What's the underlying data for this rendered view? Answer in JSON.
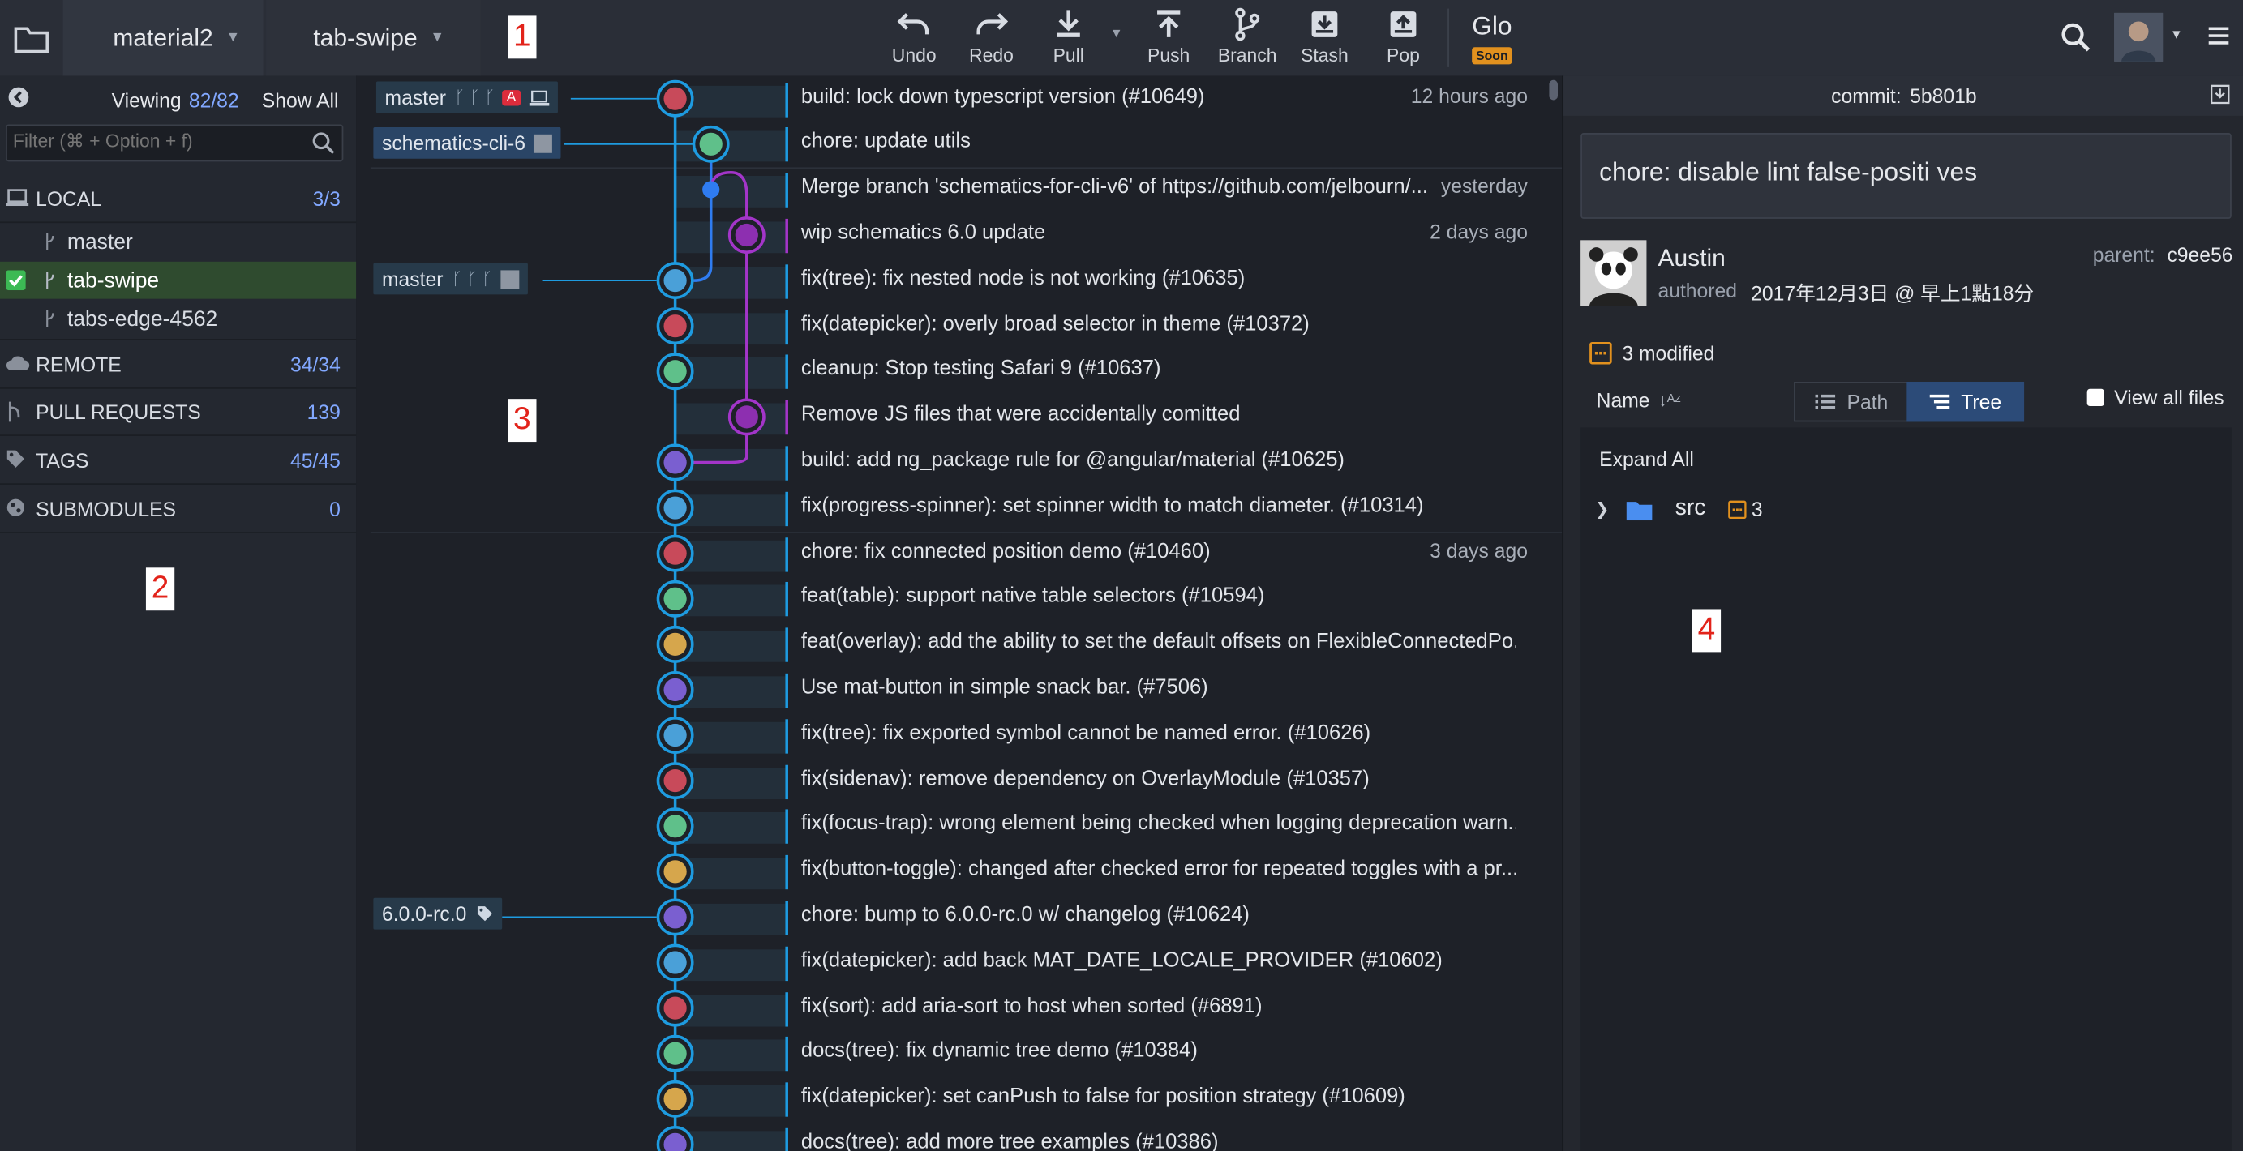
{
  "toolbar": {
    "repo": "material2",
    "branch": "tab-swipe",
    "undo": "Undo",
    "redo": "Redo",
    "pull": "Pull",
    "push": "Push",
    "branch_btn": "Branch",
    "stash": "Stash",
    "pop": "Pop",
    "glo": "Glo",
    "soon": "Soon"
  },
  "annotations": [
    "1",
    "2",
    "3",
    "4"
  ],
  "left": {
    "viewing_label": "Viewing",
    "viewing_count": "82/82",
    "show_all": "Show All",
    "filter_placeholder": "Filter (⌘ + Option + f)",
    "local": {
      "label": "LOCAL",
      "count": "3/3"
    },
    "branches": [
      "master",
      "tab-swipe",
      "tabs-edge-4562"
    ],
    "remote": {
      "label": "REMOTE",
      "count": "34/34"
    },
    "pull_requests": {
      "label": "PULL REQUESTS",
      "count": "139"
    },
    "tags": {
      "label": "TAGS",
      "count": "45/45"
    },
    "submodules": {
      "label": "SUBMODULES",
      "count": "0"
    }
  },
  "graph": {
    "refs": {
      "master": "master",
      "schematics": "schematics-cli-6",
      "tag": "6.0.0-rc.0"
    },
    "commits": [
      {
        "msg": "build: lock down typescript version (#10649)",
        "time": "12 hours ago"
      },
      {
        "msg": "chore: update utils",
        "time": ""
      },
      {
        "msg": "Merge branch 'schematics-for-cli-v6' of https://github.com/jelbourn/...",
        "time": "yesterday"
      },
      {
        "msg": "wip schematics 6.0 update",
        "time": "2 days ago"
      },
      {
        "msg": "fix(tree): fix nested node is not working (#10635)",
        "time": ""
      },
      {
        "msg": "fix(datepicker): overly broad selector in theme (#10372)",
        "time": ""
      },
      {
        "msg": "cleanup: Stop testing Safari 9 (#10637)",
        "time": ""
      },
      {
        "msg": "Remove JS files that were accidentally comitted",
        "time": ""
      },
      {
        "msg": "build: add ng_package rule for @angular/material (#10625)",
        "time": ""
      },
      {
        "msg": "fix(progress-spinner): set spinner width to match diameter. (#10314)",
        "time": ""
      },
      {
        "msg": "chore: fix connected position demo (#10460)",
        "time": "3 days ago"
      },
      {
        "msg": "feat(table): support native table selectors (#10594)",
        "time": ""
      },
      {
        "msg": "feat(overlay): add the ability to set the default offsets on FlexibleConnectedPo...",
        "time": ""
      },
      {
        "msg": "Use mat-button in simple snack bar. (#7506)",
        "time": ""
      },
      {
        "msg": "fix(tree): fix exported symbol cannot be named error. (#10626)",
        "time": ""
      },
      {
        "msg": "fix(sidenav): remove dependency on OverlayModule (#10357)",
        "time": ""
      },
      {
        "msg": "fix(focus-trap): wrong element being checked when logging deprecation warn...",
        "time": ""
      },
      {
        "msg": "fix(button-toggle): changed after checked error for repeated toggles with a pr...",
        "time": ""
      },
      {
        "msg": "chore: bump to 6.0.0-rc.0 w/ changelog (#10624)",
        "time": ""
      },
      {
        "msg": "fix(datepicker): add back MAT_DATE_LOCALE_PROVIDER (#10602)",
        "time": ""
      },
      {
        "msg": "fix(sort): add aria-sort to host when sorted (#6891)",
        "time": ""
      },
      {
        "msg": "docs(tree): fix dynamic tree demo (#10384)",
        "time": ""
      },
      {
        "msg": "fix(datepicker): set canPush to false for position strategy (#10609)",
        "time": ""
      },
      {
        "msg": "docs(tree): add more tree examples (#10386)",
        "time": ""
      }
    ]
  },
  "right": {
    "commit_label": "commit:",
    "commit_sha": "5b801b",
    "summary": "chore: disable lint false-positi ves",
    "author": "Austin",
    "authored_label": "authored",
    "authored_date": "2017年12月3日 @ 早上1點18分",
    "parent_label": "parent:",
    "parent_sha": "c9ee56",
    "modified": "3 modified",
    "name_label": "Name",
    "path_tab": "Path",
    "tree_tab": "Tree",
    "view_all": "View all files",
    "expand_all": "Expand All",
    "folder": "src",
    "folder_count": "3"
  },
  "colors": {
    "accent": "#1e9be0",
    "purple": "#a335c9",
    "tag": "#273a4a",
    "count": "#82a8ff",
    "soon": "#e2911e"
  }
}
